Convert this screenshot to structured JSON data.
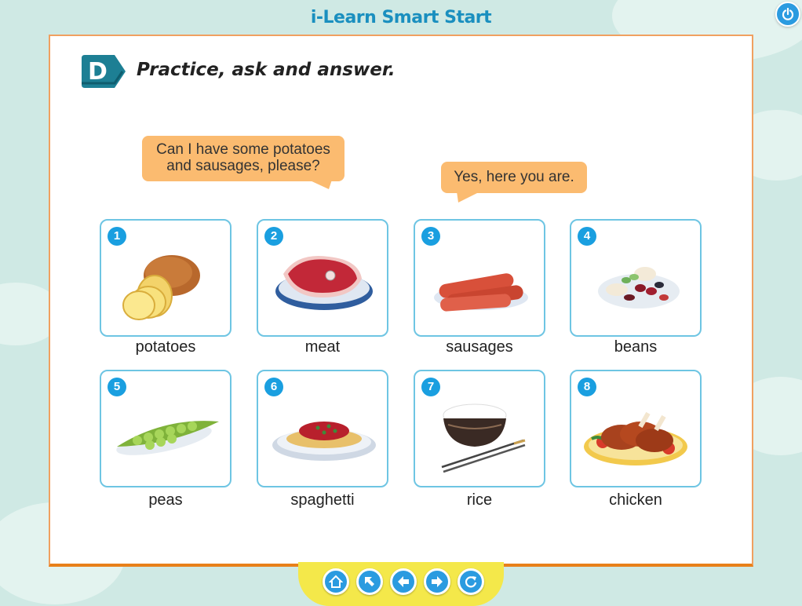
{
  "app": {
    "title": "i-Learn Smart Start"
  },
  "exercise": {
    "letter": "D",
    "instruction": "Practice, ask and answer."
  },
  "dialogue": {
    "question_line1": "Can I have some potatoes",
    "question_line2": "and sausages, please?",
    "answer": "Yes, here you are."
  },
  "foods": [
    {
      "number": "1",
      "label": "potatoes",
      "icon": "potatoes-icon"
    },
    {
      "number": "2",
      "label": "meat",
      "icon": "meat-icon"
    },
    {
      "number": "3",
      "label": "sausages",
      "icon": "sausages-icon"
    },
    {
      "number": "4",
      "label": "beans",
      "icon": "beans-icon"
    },
    {
      "number": "5",
      "label": "peas",
      "icon": "peas-icon"
    },
    {
      "number": "6",
      "label": "spaghetti",
      "icon": "spaghetti-icon"
    },
    {
      "number": "7",
      "label": "rice",
      "icon": "rice-icon"
    },
    {
      "number": "8",
      "label": "chicken",
      "icon": "chicken-icon"
    }
  ],
  "navigation": [
    {
      "icon": "home-icon"
    },
    {
      "icon": "arrow-up-left-icon"
    },
    {
      "icon": "arrow-left-icon"
    },
    {
      "icon": "arrow-right-icon"
    },
    {
      "icon": "refresh-icon"
    }
  ],
  "colors": {
    "accent": "#1a9fe0",
    "bubble": "#fbbb70",
    "page_border": "#f0a060",
    "badge": "#1d7f94"
  }
}
